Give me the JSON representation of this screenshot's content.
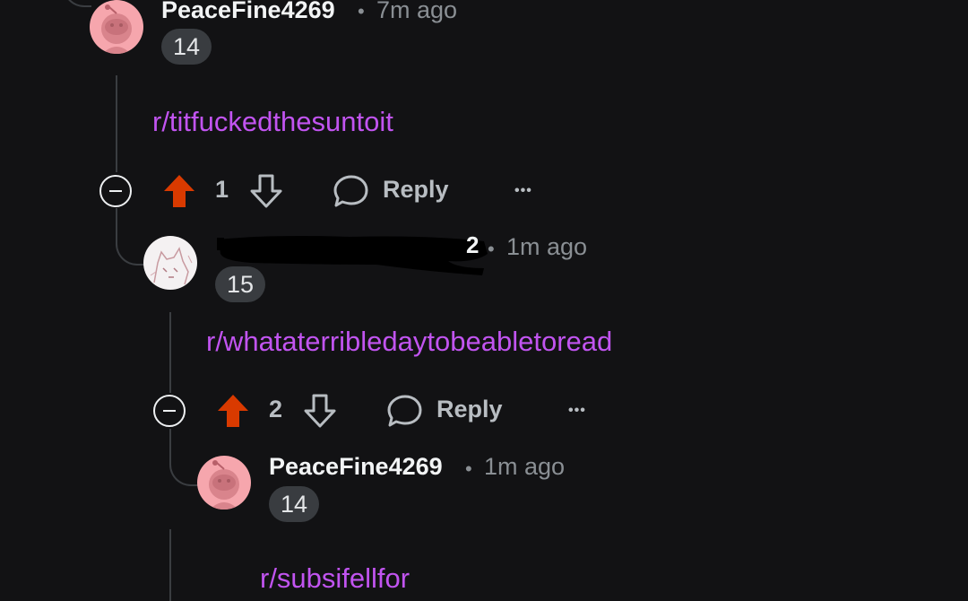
{
  "comments": [
    {
      "username": "PeaceFine4269",
      "separator": "•",
      "time": "7m ago",
      "flair": "14",
      "body": "r/titfuckedthesuntoit",
      "votes": "1",
      "reply_label": "Reply",
      "more_label": "•••"
    },
    {
      "username": "",
      "username_redacted": true,
      "username_tail": "2",
      "separator": "•",
      "time": "1m ago",
      "flair": "15",
      "body": "r/whataterribledaytobeabletoread",
      "votes": "2",
      "reply_label": "Reply",
      "more_label": "•••"
    },
    {
      "username": "PeaceFine4269",
      "separator": "•",
      "time": "1m ago",
      "flair": "14",
      "body": "r/subsifellfor"
    }
  ],
  "colors": {
    "background": "#121214",
    "upvote_active": "#d93a00",
    "link": "#c154f0",
    "thread_line": "#3a3d41"
  }
}
